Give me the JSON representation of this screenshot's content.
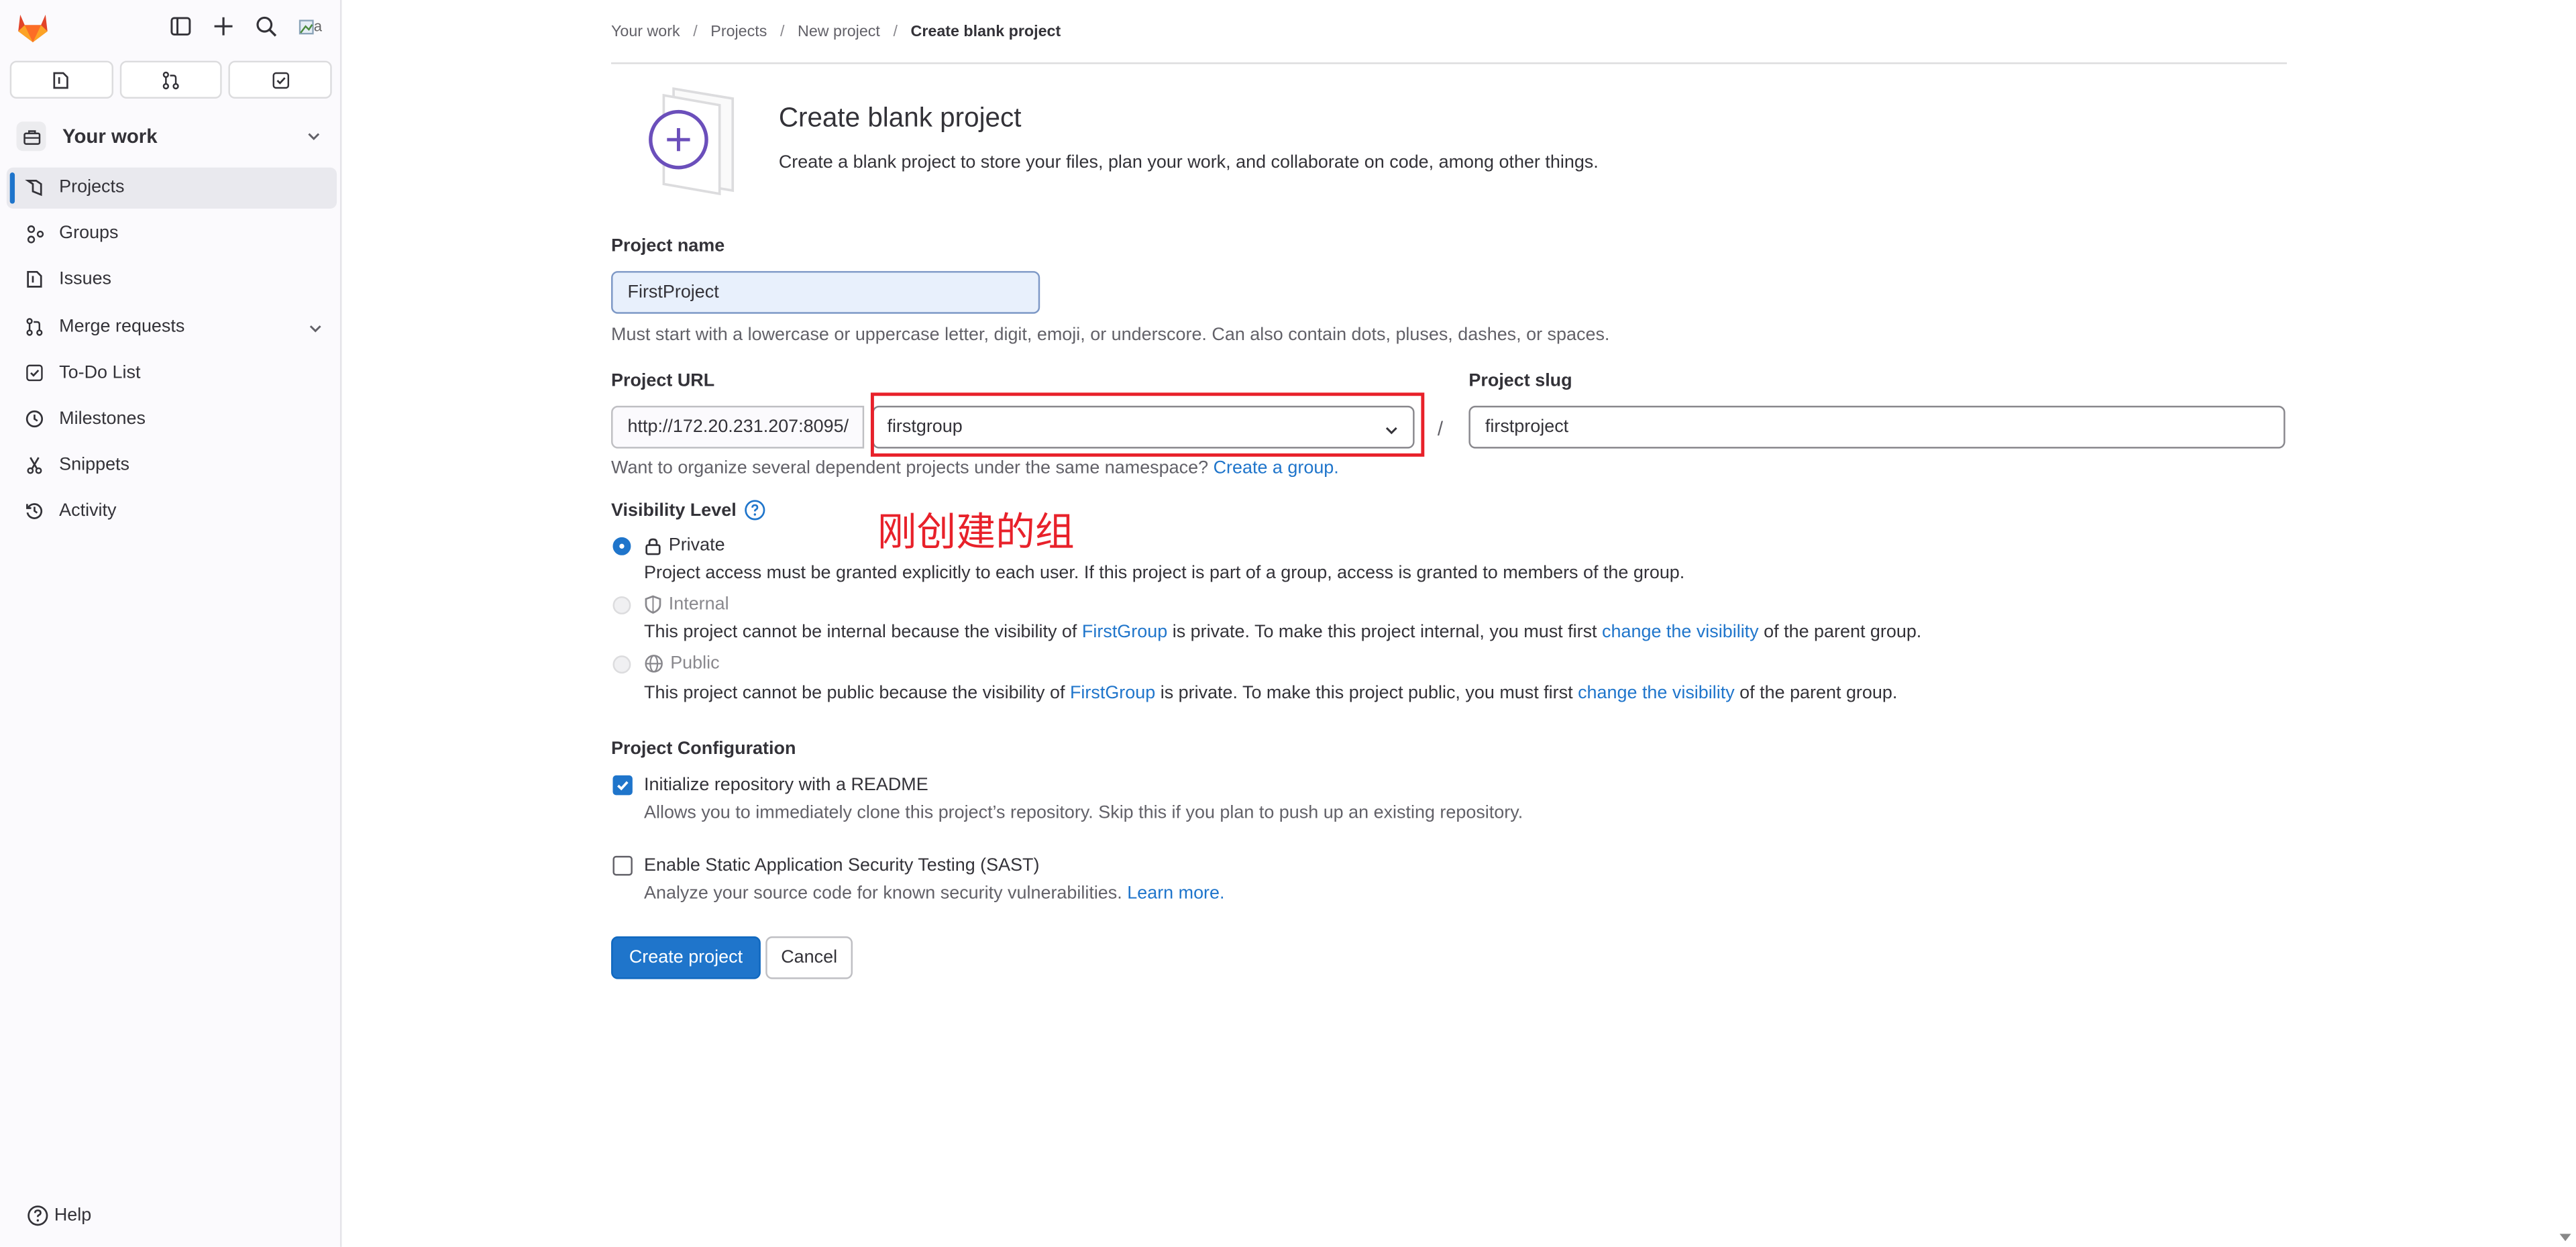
{
  "sidebar": {
    "avatar_alt": "a",
    "context": {
      "label": "Your work"
    },
    "items": [
      {
        "label": "Projects",
        "icon": "project-icon",
        "active": true
      },
      {
        "label": "Groups",
        "icon": "group-icon"
      },
      {
        "label": "Issues",
        "icon": "issues-icon"
      },
      {
        "label": "Merge requests",
        "icon": "merge-request-icon",
        "expandable": true
      },
      {
        "label": "To-Do List",
        "icon": "todo-icon"
      },
      {
        "label": "Milestones",
        "icon": "milestone-icon"
      },
      {
        "label": "Snippets",
        "icon": "snippet-icon"
      },
      {
        "label": "Activity",
        "icon": "history-icon"
      }
    ],
    "help_label": "Help"
  },
  "breadcrumb": {
    "items": [
      "Your work",
      "Projects",
      "New project"
    ],
    "current": "Create blank project"
  },
  "page": {
    "title": "Create blank project",
    "description": "Create a blank project to store your files, plan your work, and collaborate on code, among other things."
  },
  "form": {
    "project_name": {
      "label": "Project name",
      "value": "FirstProject",
      "help": "Must start with a lowercase or uppercase letter, digit, emoji, or underscore. Can also contain dots, pluses, dashes, or spaces."
    },
    "project_url": {
      "label": "Project URL",
      "prefix": "http://172.20.231.207:8095/",
      "namespace": "firstgroup",
      "separator": "/"
    },
    "project_slug": {
      "label": "Project slug",
      "value": "firstproject"
    },
    "namespace_help": {
      "text": "Want to organize several dependent projects under the same namespace?",
      "link": "Create a group."
    },
    "annotation": "刚创建的组",
    "visibility": {
      "label": "Visibility Level",
      "options": [
        {
          "title": "Private",
          "checked": true,
          "desc": "Project access must be granted explicitly to each user. If this project is part of a group, access is granted to members of the group."
        },
        {
          "title": "Internal",
          "disabled": true,
          "desc_pre": "This project cannot be internal because the visibility of",
          "group_link": "FirstGroup",
          "desc_mid": "is private. To make this project internal, you must first",
          "change_link": "change the visibility",
          "desc_post": "of the parent group."
        },
        {
          "title": "Public",
          "disabled": true,
          "desc_pre": "This project cannot be public because the visibility of",
          "group_link": "FirstGroup",
          "desc_mid": "is private. To make this project public, you must first",
          "change_link": "change the visibility",
          "desc_post": "of the parent group."
        }
      ]
    },
    "configuration": {
      "label": "Project Configuration",
      "readme": {
        "label": "Initialize repository with a README",
        "checked": true,
        "help": "Allows you to immediately clone this project’s repository. Skip this if you plan to push up an existing repository."
      },
      "sast": {
        "label": "Enable Static Application Security Testing (SAST)",
        "checked": false,
        "help": "Analyze your source code for known security vulnerabilities.",
        "link": "Learn more."
      }
    },
    "buttons": {
      "create": "Create project",
      "cancel": "Cancel"
    }
  },
  "colors": {
    "accent": "#1f75cb",
    "annotation": "#e8212a",
    "sidebar_bg": "#fbfafd"
  }
}
